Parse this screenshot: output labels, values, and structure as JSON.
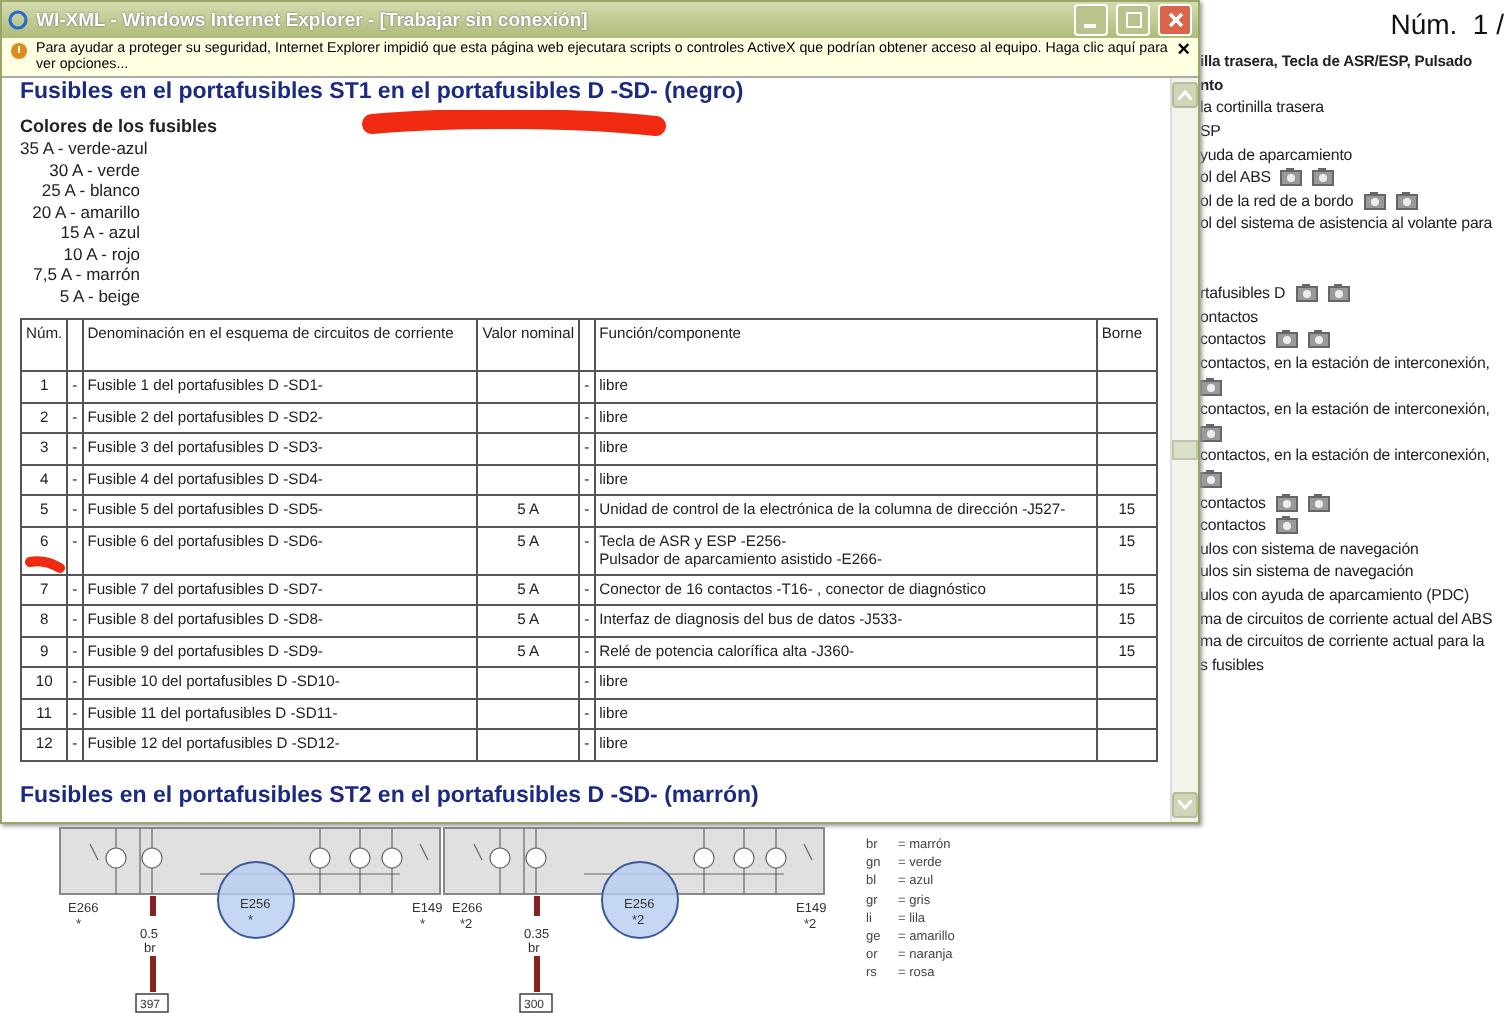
{
  "window": {
    "title": "WI-XML - Windows Internet Explorer - [Trabajar sin conexión]",
    "infobar": "Para ayudar a proteger su seguridad, Internet Explorer impidió que esta página web ejecutara scripts o controles ActiveX que podrían obtener acceso al equipo. Haga clic aquí para ver opciones...",
    "infobar_close": "×"
  },
  "content": {
    "heading": "Fusibles en el portafusibles ST1 en el portafusibles D -SD- (negro)",
    "colors_title": "Colores de los fusibles",
    "colors": [
      "35 A - verde-azul",
      "30 A - verde",
      "25 A - blanco",
      "20 A - amarillo",
      "15 A - azul",
      "10 A - rojo",
      "7,5 A - marrón",
      "5 A - beige"
    ],
    "table": {
      "columns": [
        "Núm.",
        "",
        "Denominación en el esquema de circuitos de corriente",
        "Valor nominal",
        "",
        "Función/componente",
        "Borne"
      ],
      "rows": [
        {
          "num": "1",
          "dash1": "-",
          "name": "Fusible 1 del portafusibles D -SD1-",
          "dash2": "-",
          "function": [
            "libre"
          ]
        },
        {
          "num": "2",
          "dash1": "-",
          "name": "Fusible 2 del portafusibles D -SD2-",
          "dash2": "-",
          "function": [
            "libre"
          ]
        },
        {
          "num": "3",
          "dash1": "-",
          "name": "Fusible 3 del portafusibles D -SD3-",
          "dash2": "-",
          "function": [
            "libre"
          ]
        },
        {
          "num": "4",
          "dash1": "-",
          "name": "Fusible 4 del portafusibles D -SD4-",
          "dash2": "-",
          "function": [
            "libre"
          ]
        },
        {
          "num": "5",
          "dash1": "-",
          "name": "Fusible 5 del portafusibles D -SD5-",
          "value": "5 A",
          "dash2": "-",
          "function": [
            "Unidad de control de la electrónica de la columna de dirección -J527-"
          ],
          "borne": "15"
        },
        {
          "num": "6",
          "dash1": "-",
          "name": "Fusible 6 del portafusibles D -SD6-",
          "value": "5 A",
          "dash2": "-",
          "function": [
            "Tecla de ASR y ESP -E256-",
            "Pulsador de aparcamiento asistido -E266-"
          ],
          "borne": "15"
        },
        {
          "num": "7",
          "dash1": "-",
          "name": "Fusible 7 del portafusibles D -SD7-",
          "value": "5 A",
          "dash2": "-",
          "function": [
            "Conector de 16 contactos -T16- , conector de diagnóstico"
          ],
          "borne": "15"
        },
        {
          "num": "8",
          "dash1": "-",
          "name": "Fusible 8 del portafusibles D -SD8-",
          "value": "5 A",
          "dash2": "-",
          "function": [
            "Interfaz de diagnosis del bus de datos -J533-"
          ],
          "borne": "15"
        },
        {
          "num": "9",
          "dash1": "-",
          "name": "Fusible 9 del portafusibles D -SD9-",
          "value": "5 A",
          "dash2": "-",
          "function": [
            "Relé de potencia calorífica alta -J360-"
          ],
          "borne": "15"
        },
        {
          "num": "10",
          "dash1": "-",
          "name": "Fusible 10 del portafusibles D -SD10-",
          "dash2": "-",
          "function": [
            "libre"
          ]
        },
        {
          "num": "11",
          "dash1": "-",
          "name": "Fusible 11 del portafusibles D -SD11-",
          "dash2": "-",
          "function": [
            "libre"
          ]
        },
        {
          "num": "12",
          "dash1": "-",
          "name": "Fusible 12 del portafusibles D -SD12-",
          "dash2": "-",
          "function": [
            "libre"
          ]
        }
      ]
    },
    "heading2": "Fusibles en el portafusibles ST2 en el portafusibles D -SD- (marrón)"
  },
  "background": {
    "page_number": "Núm.  1 /",
    "lines": [
      {
        "text": "illa trasera, Tecla de ASR/ESP, Pulsado",
        "bold": true
      },
      {
        "text": "nto",
        "bold": true
      },
      {
        "text": "la cortinilla trasera"
      },
      {
        "text": "SP"
      },
      {
        "text": "yuda de aparcamiento"
      },
      {
        "text": "ol del ABS",
        "icons": [
          {
            "kind": "camera"
          },
          {
            "kind": "camera"
          }
        ]
      },
      {
        "text": "ol de la red de a bordo",
        "icons": [
          {
            "kind": "camera"
          },
          {
            "kind": "camera"
          }
        ]
      },
      {
        "text": "ol del sistema de asistencia al volante para"
      },
      {
        "kind": "blank"
      },
      {
        "kind": "blank"
      },
      {
        "text": "rtafusibles D",
        "icons": [
          {
            "kind": "camera"
          },
          {
            "kind": "camera"
          }
        ]
      },
      {
        "text": "ontactos"
      },
      {
        "text": "contactos",
        "icons": [
          {
            "kind": "camera"
          },
          {
            "kind": "camera"
          }
        ]
      },
      {
        "text": "contactos, en la estación de interconexión,"
      },
      {
        "icons": [
          {
            "kind": "camera"
          }
        ]
      },
      {
        "text": "contactos, en la estación de interconexión,"
      },
      {
        "icons": [
          {
            "kind": "camera"
          }
        ]
      },
      {
        "text": "contactos, en la estación de interconexión,"
      },
      {
        "icons": [
          {
            "kind": "camera"
          }
        ]
      },
      {
        "text": "contactos",
        "icons": [
          {
            "kind": "camera"
          },
          {
            "kind": "camera"
          }
        ]
      },
      {
        "text": "contactos",
        "icons": [
          {
            "kind": "camera"
          }
        ]
      },
      {
        "text": "ulos con sistema de navegación"
      },
      {
        "text": "ulos sin sistema de navegación"
      },
      {
        "text": "ulos con ayuda de aparcamiento (PDC)"
      },
      {
        "text": "ma de circuitos de corriente actual del ABS"
      },
      {
        "text": "ma de circuitos de corriente actual para la"
      },
      {
        "text": "s fusibles"
      }
    ],
    "diagram": [
      {
        "left": "E266",
        "left_mark": "*",
        "center": "E256",
        "center_mark": "*",
        "right": "E149",
        "right_mark": "*",
        "wire_size": "0.5",
        "wire_color": "br",
        "terminal": "397"
      },
      {
        "left": "E266",
        "left_mark": "*2",
        "center": "E256",
        "center_mark": "*2",
        "right": "E149",
        "right_mark": "*2",
        "wire_size": "0.35",
        "wire_color": "br",
        "terminal": "300"
      }
    ],
    "legend": [
      {
        "code": "br",
        "name": "= marrón"
      },
      {
        "code": "gn",
        "name": "= verde"
      },
      {
        "code": "bl",
        "name": "= azul"
      },
      {
        "code": "gr",
        "name": "= gris"
      },
      {
        "code": "li",
        "name": "= lila"
      },
      {
        "code": "ge",
        "name": "= amarillo"
      },
      {
        "code": "or",
        "name": "= naranja"
      },
      {
        "code": "rs",
        "name": "= rosa"
      }
    ]
  }
}
